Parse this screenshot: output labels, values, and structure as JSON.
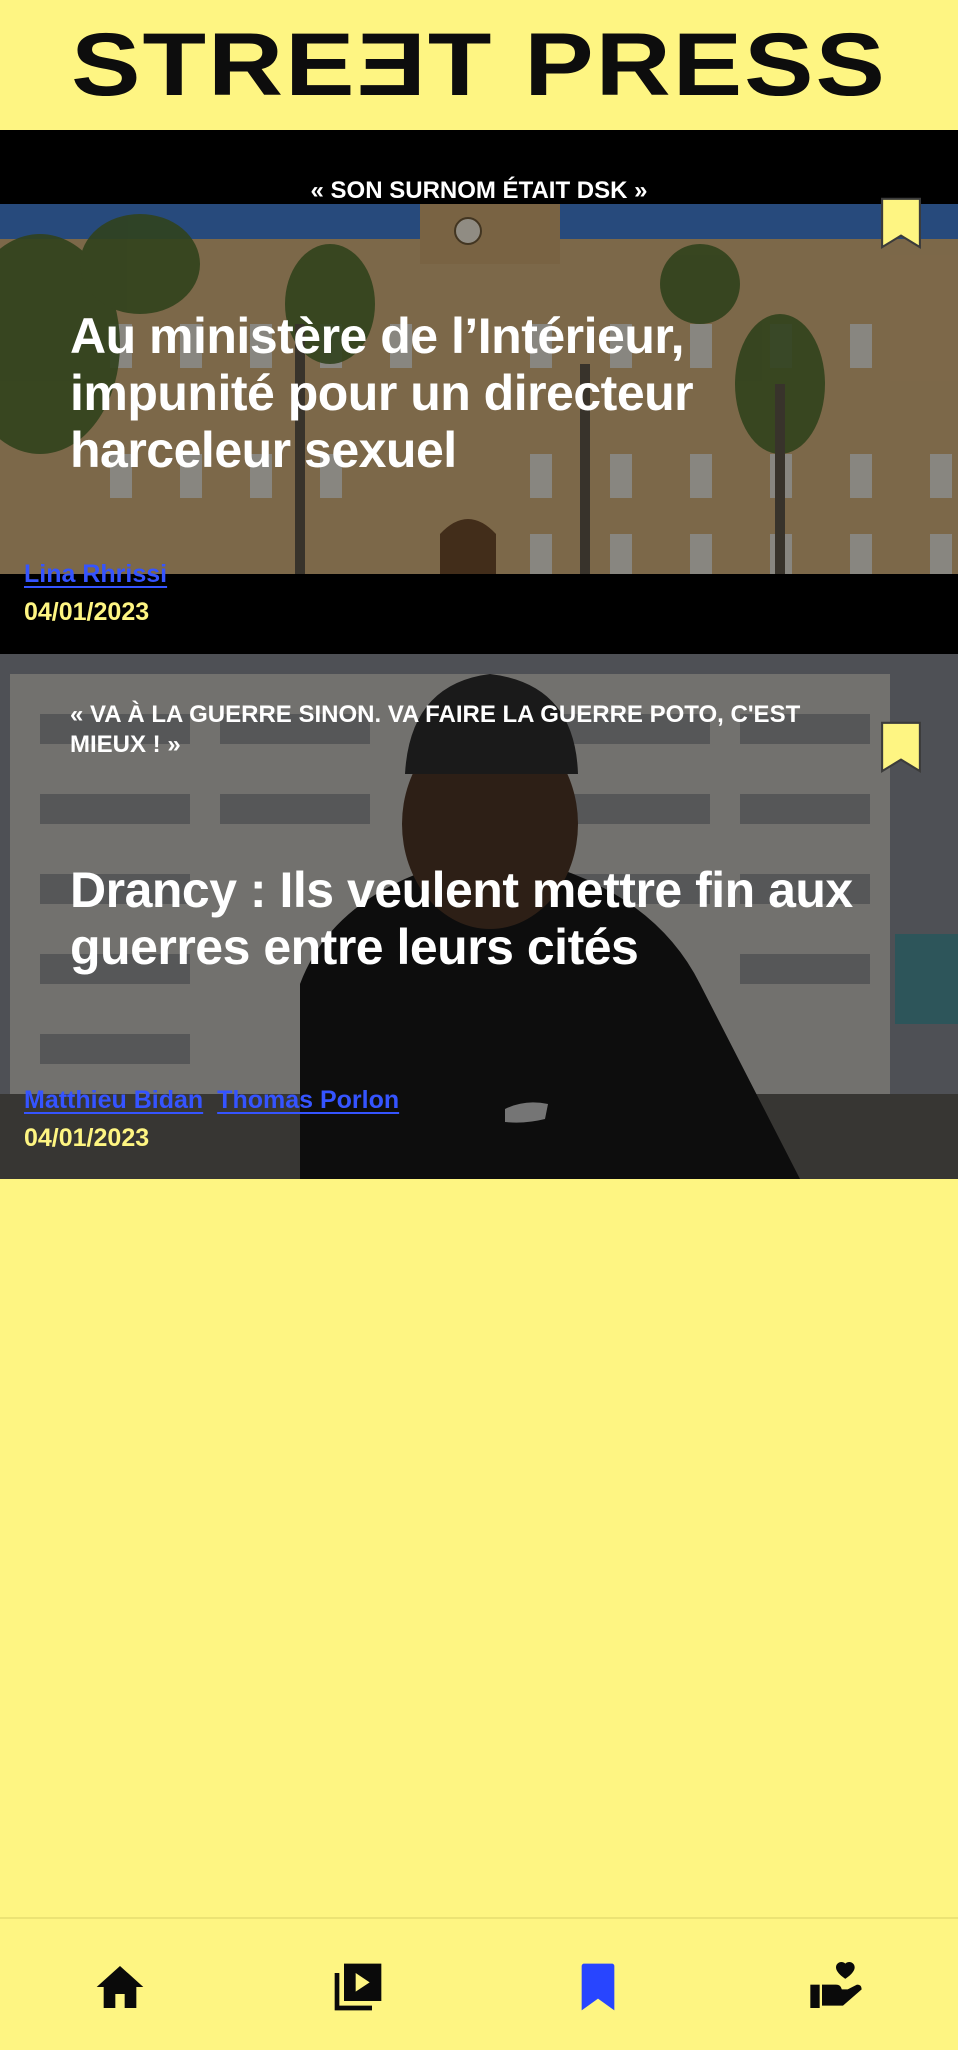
{
  "app": {
    "logo": "STREƎT PRESS"
  },
  "articles": [
    {
      "kicker": "« SON SURNOM ÉTAIT DSK »",
      "title": "Au ministère de l’Intérieur, impunité pour un directeur harceleur sexuel",
      "authors": [
        "Lina Rhrissi"
      ],
      "date": "04/01/2023"
    },
    {
      "kicker": "« VA À LA GUERRE SINON. VA FAIRE LA GUERRE POTO, C'EST MIEUX ! »",
      "title": "Drancy : Ils veulent mettre fin aux guerres entre leurs cités",
      "authors": [
        "Matthieu Bidan",
        "Thomas Porlon"
      ],
      "date": "04/01/2023"
    }
  ],
  "bottom_nav": [
    {
      "icon": "home-icon",
      "active": false
    },
    {
      "icon": "video-library-icon",
      "active": false
    },
    {
      "icon": "bookmark-icon",
      "active": true
    },
    {
      "icon": "donate-heart-icon",
      "active": false
    }
  ],
  "colors": {
    "brand_yellow": "#fef582",
    "author_blue": "#3554ff",
    "active_nav": "#2845ff"
  }
}
